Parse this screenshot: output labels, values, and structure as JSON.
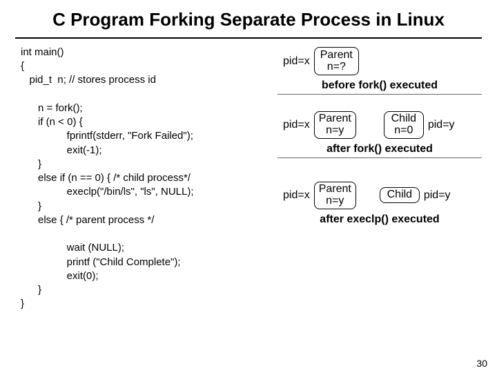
{
  "title": "C Program Forking Separate Process in Linux",
  "code": "int main()\n{\n   pid_t  n; // stores process id\n\n      n = fork();\n      if (n < 0) {\n                fprintf(stderr, \"Fork Failed\");\n                exit(-1);\n      }\n      else if (n == 0) { /* child process*/\n                execlp(\"/bin/ls\", \"ls\", NULL);\n      }\n      else { /* parent process */\n\n                wait (NULL);\n                printf (\"Child Complete\");\n                exit(0);\n      }\n}",
  "stage1": {
    "pid_left": "pid=x",
    "box": {
      "name": "Parent",
      "val": "n=?"
    },
    "caption": "before fork() executed"
  },
  "stage2": {
    "pid_left": "pid=x",
    "box1": {
      "name": "Parent",
      "val": "n=y"
    },
    "box2": {
      "name": "Child",
      "val": "n=0"
    },
    "pid_right": "pid=y",
    "caption": "after fork() executed"
  },
  "stage3": {
    "pid_left": "pid=x",
    "box1": {
      "name": "Parent",
      "val": "n=y"
    },
    "box2": {
      "name": "Child",
      "val": ""
    },
    "pid_right": "pid=y",
    "caption": "after execlp() executed"
  },
  "pagenum": "30"
}
